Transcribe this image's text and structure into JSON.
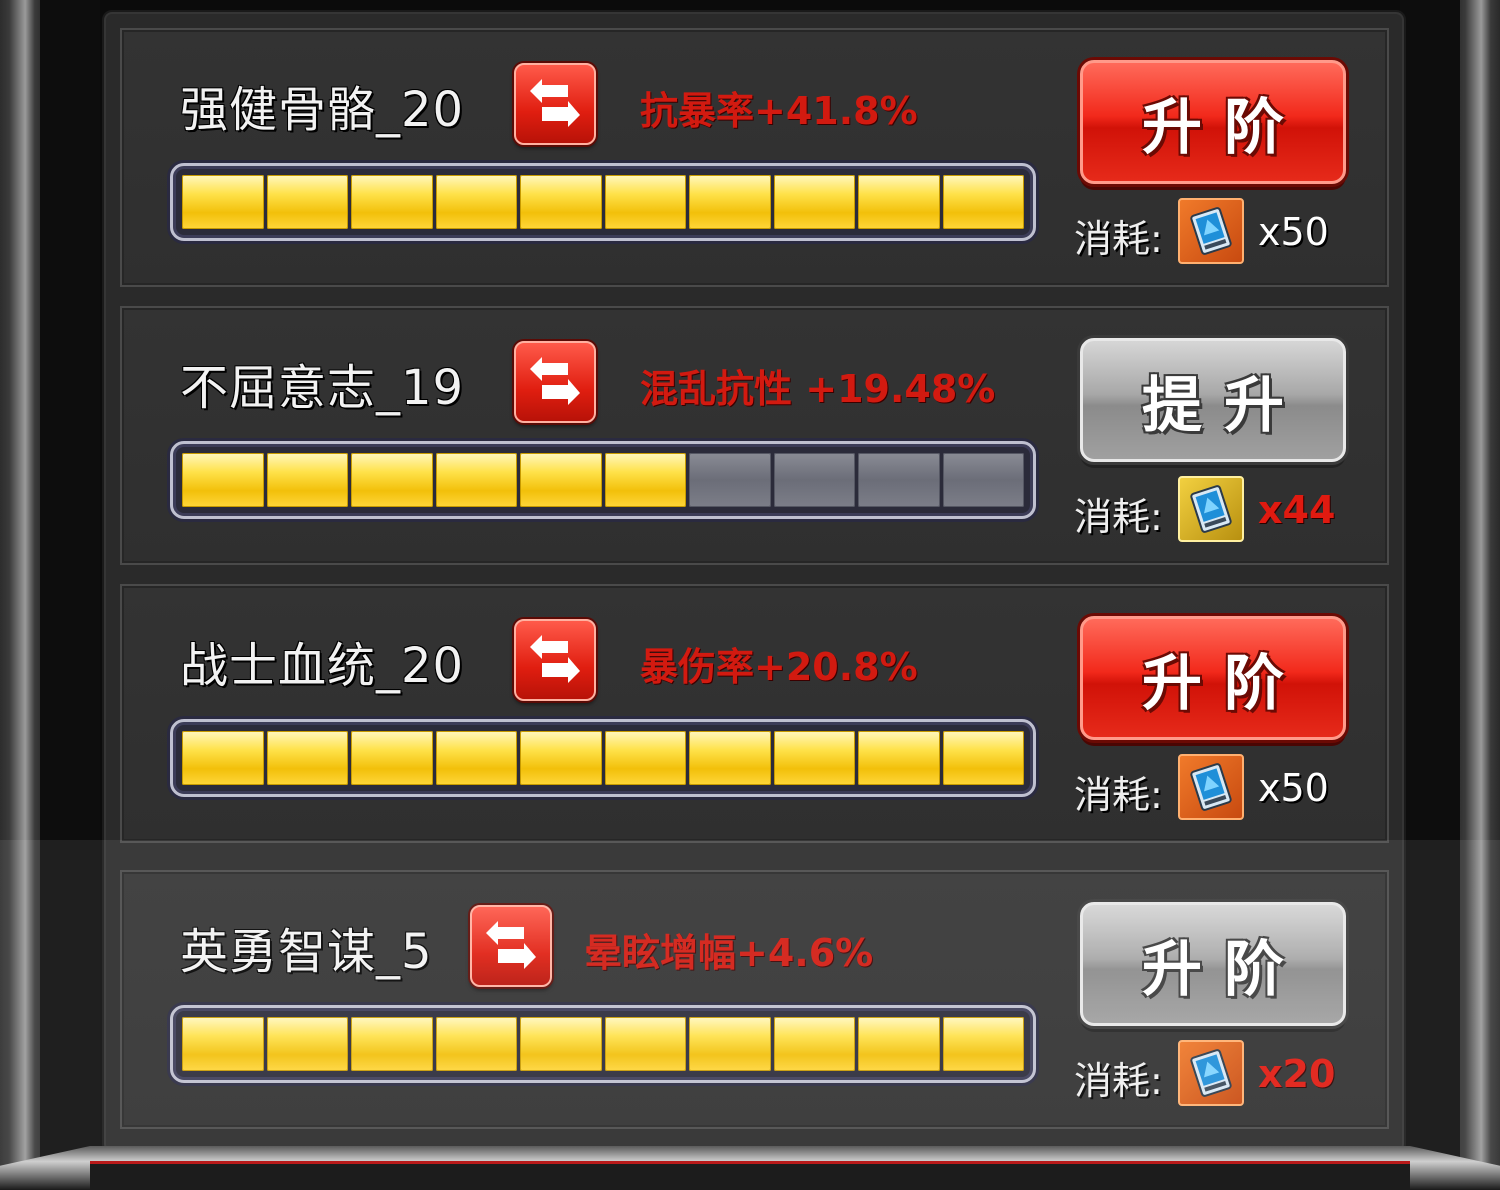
{
  "cost_label": "消耗:",
  "colors": {
    "bonus_text": "#d21a10",
    "progress_filled": "#f2c00a",
    "progress_empty": "#6b6d78",
    "button_red": "#e01e10",
    "button_gray": "#9a9a9a"
  },
  "skills": [
    {
      "name": "强健骨骼_20",
      "swap_icon": "swap-arrows-icon",
      "bonus": "抗暴率+41.8%",
      "progress": {
        "filled": 10,
        "total": 10
      },
      "action": {
        "label": "升阶",
        "style": "red"
      },
      "cost": {
        "item_icon": "blue-card-icon",
        "frame": "orange",
        "quantity": "x50",
        "sufficient": true
      }
    },
    {
      "name": "不屈意志_19",
      "swap_icon": "swap-arrows-icon",
      "bonus": "混乱抗性 +19.48%",
      "progress": {
        "filled": 6,
        "total": 10
      },
      "action": {
        "label": "提升",
        "style": "gray"
      },
      "cost": {
        "item_icon": "blue-card-icon",
        "frame": "gold",
        "quantity": "x44",
        "sufficient": false
      }
    },
    {
      "name": "战士血统_20",
      "swap_icon": "swap-arrows-icon",
      "bonus": "暴伤率+20.8%",
      "progress": {
        "filled": 10,
        "total": 10
      },
      "action": {
        "label": "升阶",
        "style": "red"
      },
      "cost": {
        "item_icon": "blue-card-icon",
        "frame": "orange",
        "quantity": "x50",
        "sufficient": true
      }
    },
    {
      "name": "英勇智谋_5",
      "swap_icon": "swap-arrows-icon",
      "bonus": "晕眩增幅+4.6%",
      "progress": {
        "filled": 10,
        "total": 10
      },
      "action": {
        "label": "升阶",
        "style": "gray"
      },
      "cost": {
        "item_icon": "blue-card-icon",
        "frame": "orange",
        "quantity": "x20",
        "sufficient": false
      }
    }
  ]
}
